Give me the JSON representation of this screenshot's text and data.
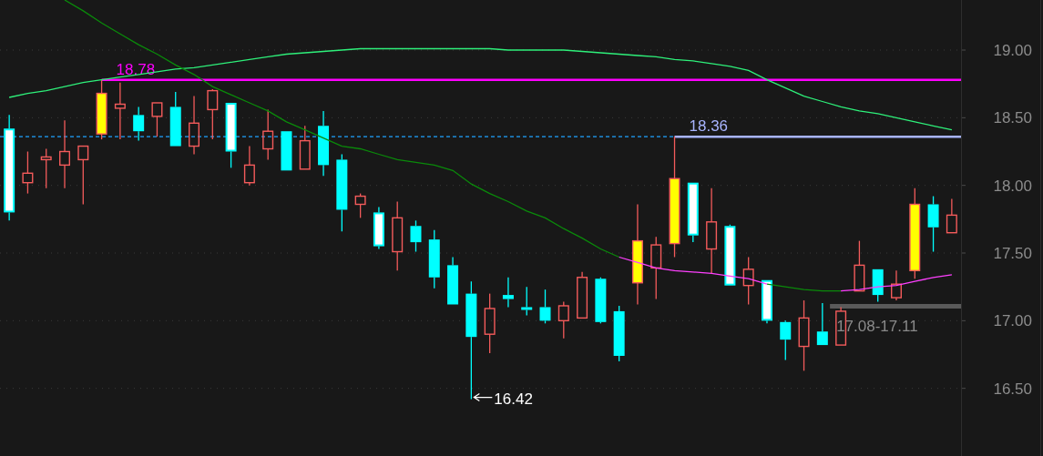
{
  "chart_data": {
    "type": "candlestick",
    "ylim": [
      16.0,
      19.37
    ],
    "grid": true,
    "yticks": [
      {
        "value": 19,
        "label": "19.00"
      },
      {
        "value": 18.5,
        "label": "18.50"
      },
      {
        "value": 18,
        "label": "18.00"
      },
      {
        "value": 17.5,
        "label": "17.50"
      },
      {
        "value": 17,
        "label": "17.00"
      },
      {
        "value": 16.5,
        "label": "16.50"
      }
    ],
    "categories": [
      null,
      null,
      null,
      null,
      null,
      null,
      null,
      null,
      null,
      null,
      null,
      null,
      null,
      null,
      null,
      null,
      null,
      null,
      null,
      null,
      null,
      null,
      null,
      null,
      null,
      null,
      null,
      null,
      null,
      null,
      null,
      null,
      null,
      null,
      null,
      null,
      null,
      null,
      null,
      null,
      null,
      null,
      null,
      null,
      null,
      null,
      null,
      null,
      null,
      null,
      null,
      null
    ],
    "ohlc": [
      [
        18.42,
        18.52,
        17.74,
        17.8
      ],
      [
        18.02,
        18.25,
        17.94,
        18.09
      ],
      [
        18.19,
        18.27,
        17.98,
        18.21
      ],
      [
        18.15,
        18.48,
        17.98,
        18.25
      ],
      [
        18.19,
        18.29,
        17.86,
        18.29
      ],
      [
        18.38,
        18.78,
        18.34,
        18.68
      ],
      [
        18.57,
        18.76,
        18.34,
        18.6
      ],
      [
        18.52,
        18.58,
        18.33,
        18.4
      ],
      [
        18.51,
        18.61,
        18.36,
        18.61
      ],
      [
        18.58,
        18.69,
        18.29,
        18.29
      ],
      [
        18.29,
        18.66,
        18.23,
        18.46
      ],
      [
        18.56,
        18.71,
        18.34,
        18.7
      ],
      [
        18.61,
        18.61,
        18.13,
        18.25
      ],
      [
        18.02,
        18.29,
        18.0,
        18.15
      ],
      [
        18.27,
        18.56,
        18.19,
        18.4
      ],
      [
        18.4,
        18.4,
        18.11,
        18.11
      ],
      [
        18.12,
        18.44,
        18.12,
        18.33
      ],
      [
        18.44,
        18.55,
        18.07,
        18.15
      ],
      [
        18.19,
        18.23,
        17.66,
        17.82
      ],
      [
        17.86,
        17.94,
        17.76,
        17.92
      ],
      [
        17.8,
        17.84,
        17.53,
        17.55
      ],
      [
        17.51,
        17.88,
        17.37,
        17.76
      ],
      [
        17.7,
        17.74,
        17.51,
        17.58
      ],
      [
        17.6,
        17.67,
        17.24,
        17.32
      ],
      [
        17.41,
        17.47,
        17.12,
        17.12
      ],
      [
        17.2,
        17.29,
        16.42,
        16.88
      ],
      [
        16.9,
        17.2,
        16.76,
        17.09
      ],
      [
        17.19,
        17.32,
        17.1,
        17.16
      ],
      [
        17.1,
        17.25,
        17.04,
        17.08
      ],
      [
        17.1,
        17.23,
        16.98,
        17.0
      ],
      [
        17.0,
        17.14,
        16.87,
        17.11
      ],
      [
        17.02,
        17.36,
        17.02,
        17.32
      ],
      [
        17.31,
        17.32,
        16.98,
        16.99
      ],
      [
        17.07,
        17.11,
        16.7,
        16.74
      ],
      [
        17.28,
        17.86,
        17.12,
        17.59
      ],
      [
        17.39,
        17.62,
        17.16,
        17.56
      ],
      [
        17.57,
        18.36,
        17.47,
        18.05
      ],
      [
        18.02,
        18.02,
        17.58,
        17.63
      ],
      [
        17.53,
        17.98,
        17.35,
        17.73
      ],
      [
        17.7,
        17.71,
        17.26,
        17.26
      ],
      [
        17.26,
        17.47,
        17.12,
        17.38
      ],
      [
        17.3,
        17.3,
        16.98,
        17.0
      ],
      [
        16.99,
        17.0,
        16.71,
        16.86
      ],
      [
        16.81,
        17.15,
        16.63,
        17.02
      ],
      [
        16.92,
        17.13,
        16.82,
        16.82
      ],
      [
        16.82,
        17.1,
        16.82,
        17.07
      ],
      [
        17.22,
        17.59,
        17.22,
        17.41
      ],
      [
        17.38,
        17.38,
        17.14,
        17.19
      ],
      [
        17.17,
        17.37,
        17.15,
        17.27
      ],
      [
        17.37,
        17.98,
        17.31,
        17.86
      ],
      [
        17.86,
        17.92,
        17.51,
        17.69
      ],
      [
        17.65,
        17.9,
        17.65,
        17.78
      ]
    ],
    "colors": [
      "#ffffff",
      null,
      null,
      null,
      null,
      "#ffff00",
      null,
      null,
      null,
      null,
      null,
      null,
      "#ffffff",
      null,
      null,
      null,
      null,
      null,
      null,
      null,
      "#ffffff",
      null,
      null,
      null,
      null,
      null,
      null,
      null,
      null,
      null,
      null,
      null,
      null,
      null,
      "#ffff00",
      null,
      "#ffff00",
      "#ffffff",
      null,
      "#ffffff",
      null,
      "#ffffff",
      null,
      null,
      null,
      null,
      null,
      null,
      null,
      "#ffff00",
      null,
      null
    ],
    "series": [
      {
        "type": "line",
        "color": "#2ef07a",
        "values": [
          18.65,
          18.68,
          18.7,
          18.73,
          18.76,
          18.78,
          18.8,
          18.82,
          18.84,
          18.86,
          18.87,
          18.89,
          18.91,
          18.93,
          18.95,
          18.97,
          18.98,
          18.99,
          19.0,
          19.01,
          19.01,
          19.01,
          19.01,
          19.01,
          19.01,
          19.01,
          19.01,
          19.0,
          19.0,
          19.0,
          19.0,
          18.99,
          18.98,
          18.97,
          18.96,
          18.95,
          18.93,
          18.92,
          18.9,
          18.88,
          18.85,
          18.78,
          18.72,
          18.66,
          18.62,
          18.58,
          18.55,
          18.53,
          18.5,
          18.47,
          18.44,
          18.41
        ]
      },
      {
        "type": "line",
        "color": "#0a8a0a",
        "values": [
          null,
          null,
          null,
          19.37,
          19.29,
          19.2,
          19.12,
          19.04,
          18.97,
          18.89,
          18.82,
          18.73,
          18.67,
          18.61,
          18.55,
          18.47,
          18.41,
          18.35,
          18.29,
          18.27,
          18.23,
          18.19,
          18.17,
          18.15,
          18.11,
          18.01,
          17.94,
          17.88,
          17.81,
          17.76,
          17.68,
          17.61,
          17.53,
          17.47,
          null,
          null,
          null,
          null,
          null,
          null,
          null,
          17.27,
          17.25,
          17.23,
          17.22,
          17.22,
          null,
          null,
          null,
          null,
          null,
          null
        ]
      },
      {
        "type": "line",
        "color": "#ff40ff",
        "values": [
          null,
          null,
          null,
          null,
          null,
          null,
          null,
          null,
          null,
          null,
          null,
          null,
          null,
          null,
          null,
          null,
          null,
          null,
          null,
          null,
          null,
          null,
          null,
          null,
          null,
          null,
          null,
          null,
          null,
          null,
          null,
          null,
          null,
          17.47,
          17.43,
          17.39,
          17.37,
          17.36,
          17.35,
          17.33,
          17.31,
          17.27,
          null,
          null,
          null,
          17.22,
          17.23,
          17.25,
          17.26,
          17.29,
          17.32,
          17.34
        ]
      }
    ],
    "ref_lines": [
      {
        "axis": "y",
        "value": 18.36,
        "color": "#1fa3ff"
      },
      {
        "axis": "y",
        "value": 18.78,
        "label": "18.78",
        "color": "#ff00ff"
      },
      {
        "axis": "y",
        "value": 18.36,
        "label": "18.36",
        "color": "#a8b4ff"
      }
    ],
    "bands": [
      {
        "axis": "y",
        "from": 17.08,
        "to": 17.11,
        "label": "17.08-17.11"
      }
    ],
    "annotations": [
      {
        "text": "16.42"
      }
    ]
  }
}
